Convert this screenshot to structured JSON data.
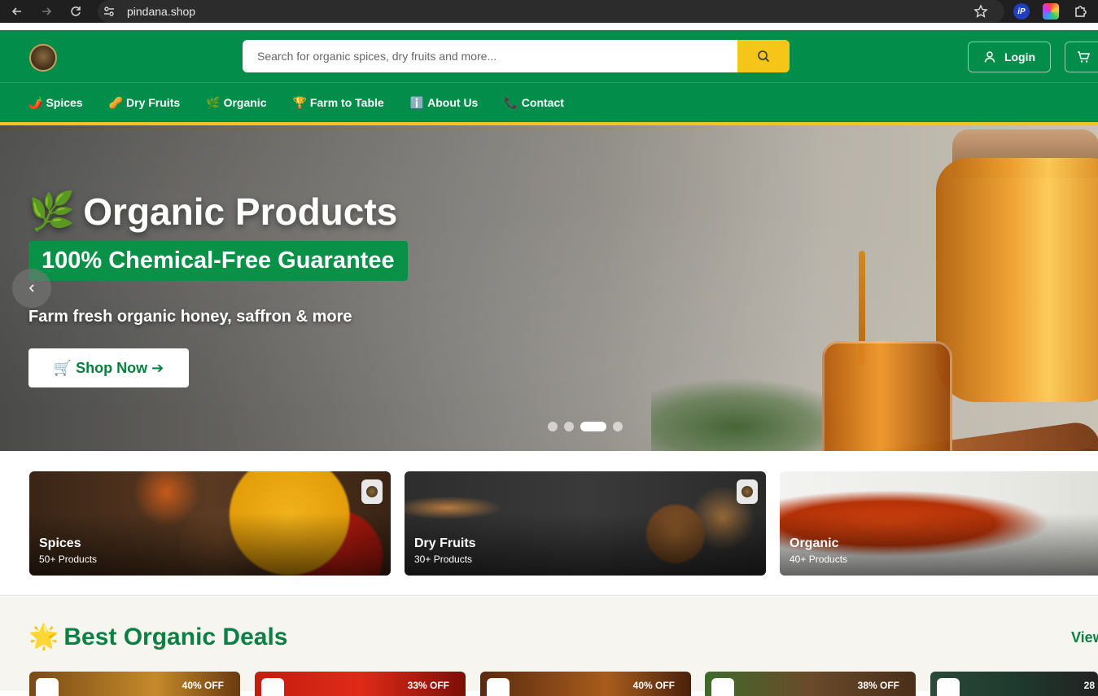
{
  "browser": {
    "url": "pindana.shop"
  },
  "header": {
    "search_placeholder": "Search for organic spices, dry fruits and more...",
    "login_label": "Login"
  },
  "nav": {
    "items": [
      {
        "icon": "🌶️",
        "label": "Spices"
      },
      {
        "icon": "🥜",
        "label": "Dry Fruits"
      },
      {
        "icon": "🌿",
        "label": "Organic"
      },
      {
        "icon": "🏆",
        "label": "Farm to Table"
      },
      {
        "icon": "ℹ️",
        "label": "About Us"
      },
      {
        "icon": "📞",
        "label": "Contact"
      }
    ]
  },
  "hero": {
    "title_icon": "🌿",
    "title": "Organic Products",
    "badge": "100% Chemical-Free Guarantee",
    "subtitle": "Farm fresh organic honey, saffron & more",
    "cta": "🛒 Shop Now ➔",
    "active_slide": 3,
    "slide_count": 4
  },
  "categories": [
    {
      "name": "Spices",
      "count": "50+ Products"
    },
    {
      "name": "Dry Fruits",
      "count": "30+ Products"
    },
    {
      "name": "Organic",
      "count": "40+ Products"
    }
  ],
  "deals": {
    "title_icon": "🌟",
    "title": "Best Organic Deals",
    "view_label": "View",
    "items": [
      {
        "discount": "40% OFF"
      },
      {
        "discount": "33% OFF"
      },
      {
        "discount": "40% OFF"
      },
      {
        "discount": "38% OFF"
      },
      {
        "discount": "28"
      }
    ]
  },
  "colors": {
    "brand_green": "#028d4a",
    "accent_yellow": "#f5c517"
  }
}
